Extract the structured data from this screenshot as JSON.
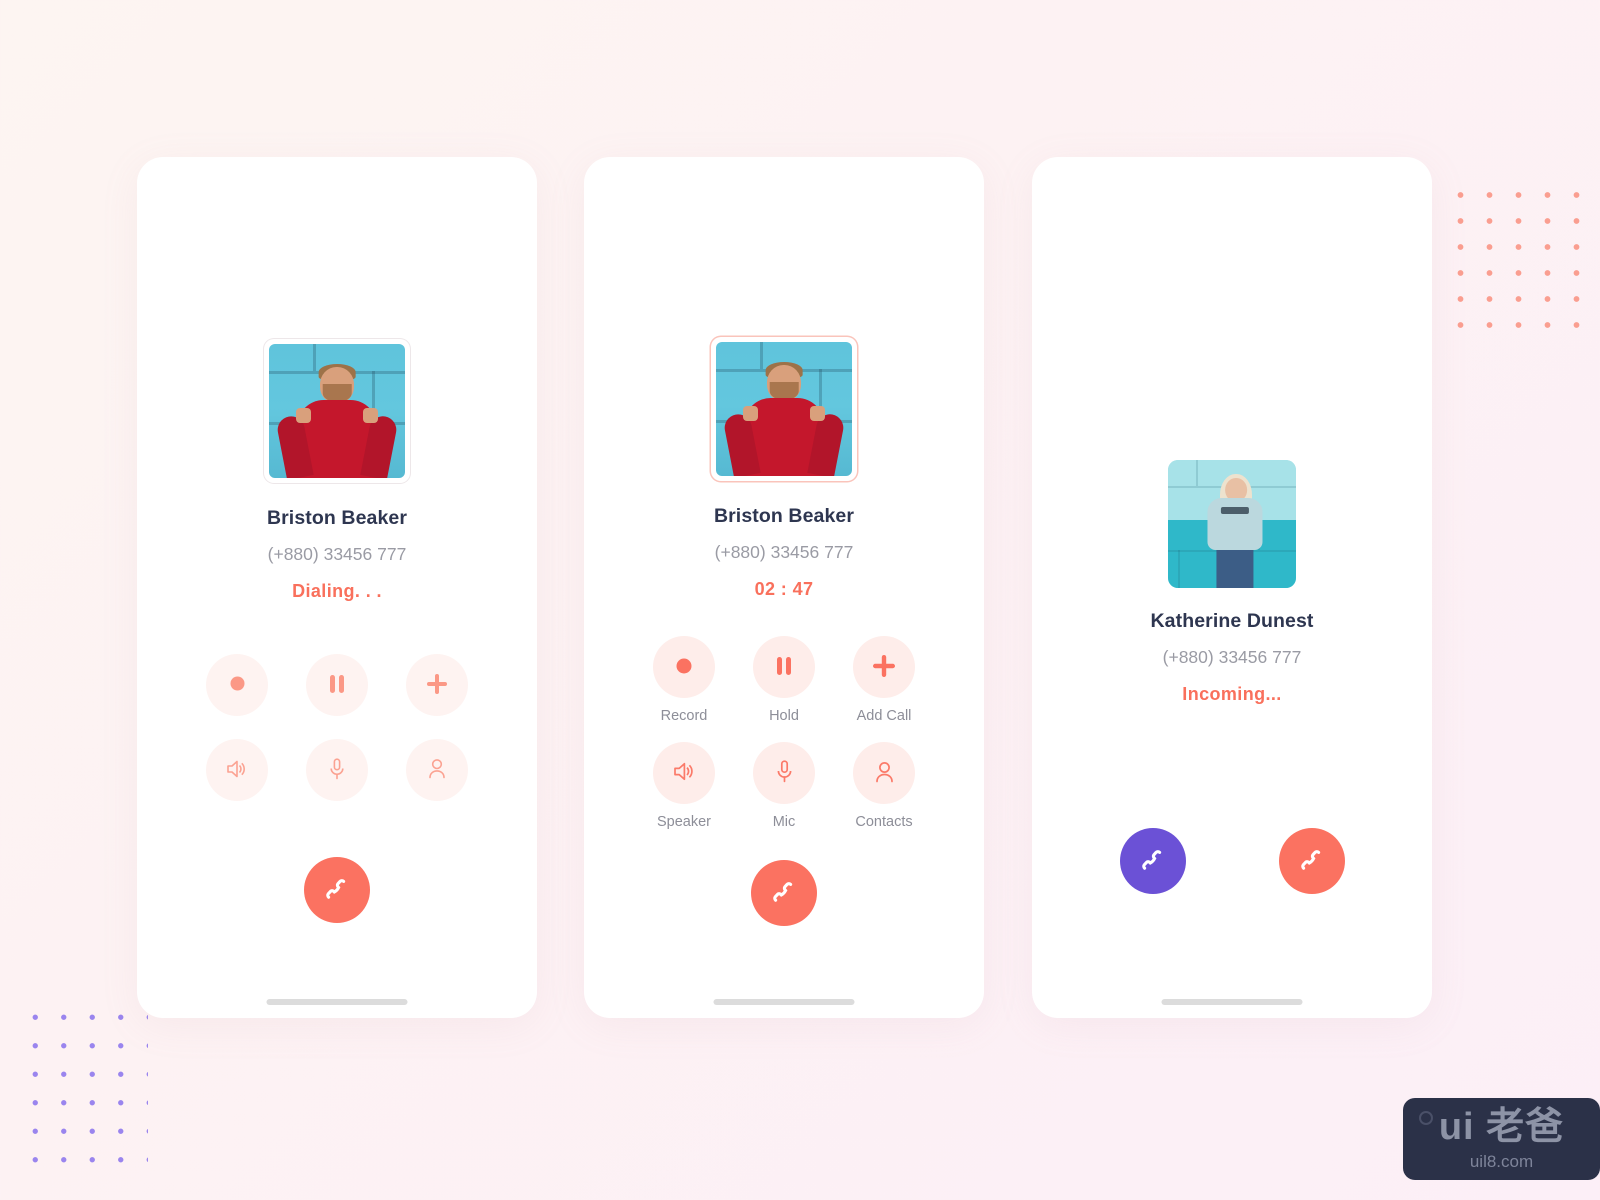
{
  "theme": {
    "accent_coral": "#FB7261",
    "accent_purple": "#6B51D6",
    "status_text_color": "#F9705C",
    "name_color": "#2E3650",
    "phone_color": "#9A9BA4",
    "button_bg": "#FEEDEA",
    "page_bg_start": "#FDF5F2",
    "page_bg_end": "#FCEFF7",
    "dot_coral": "#FA9E90",
    "dot_purple": "#9A85EE"
  },
  "screens": [
    {
      "id": "dialing",
      "avatar_alt": "man-in-red-sweater-photo",
      "name": "Briston Beaker",
      "phone": "(+880) 33456 777",
      "status": "Dialing. . .",
      "show_labels": false,
      "controls": [
        {
          "icon": "record-icon",
          "label": "Record"
        },
        {
          "icon": "pause-icon",
          "label": "Hold"
        },
        {
          "icon": "plus-icon",
          "label": "Add Call"
        },
        {
          "icon": "speaker-icon",
          "label": "Speaker"
        },
        {
          "icon": "mic-icon",
          "label": "Mic"
        },
        {
          "icon": "contacts-icon",
          "label": "Contacts"
        }
      ],
      "actions": [
        {
          "icon": "end-call-icon",
          "label": "End Call",
          "color": "#FB7261"
        }
      ]
    },
    {
      "id": "in-call",
      "avatar_alt": "man-in-red-sweater-photo",
      "name": "Briston Beaker",
      "phone": "(+880) 33456 777",
      "status": "02 : 47",
      "show_labels": true,
      "controls": [
        {
          "icon": "record-icon",
          "label": "Record"
        },
        {
          "icon": "pause-icon",
          "label": "Hold"
        },
        {
          "icon": "plus-icon",
          "label": "Add Call"
        },
        {
          "icon": "speaker-icon",
          "label": "Speaker"
        },
        {
          "icon": "mic-icon",
          "label": "Mic"
        },
        {
          "icon": "contacts-icon",
          "label": "Contacts"
        }
      ],
      "actions": [
        {
          "icon": "end-call-icon",
          "label": "End Call",
          "color": "#FB7261"
        }
      ]
    },
    {
      "id": "incoming",
      "avatar_alt": "woman-in-blue-sweatshirt-photo",
      "name": "Katherine Dunest",
      "phone": "(+880) 33456 777",
      "status": "Incoming...",
      "show_labels": false,
      "controls": [],
      "actions": [
        {
          "icon": "accept-call-icon",
          "label": "Accept",
          "color": "#6B51D6"
        },
        {
          "icon": "decline-call-icon",
          "label": "Decline",
          "color": "#FB7261"
        }
      ]
    }
  ],
  "watermark": {
    "logo": "ui 老爸",
    "url": "uil8.com"
  }
}
